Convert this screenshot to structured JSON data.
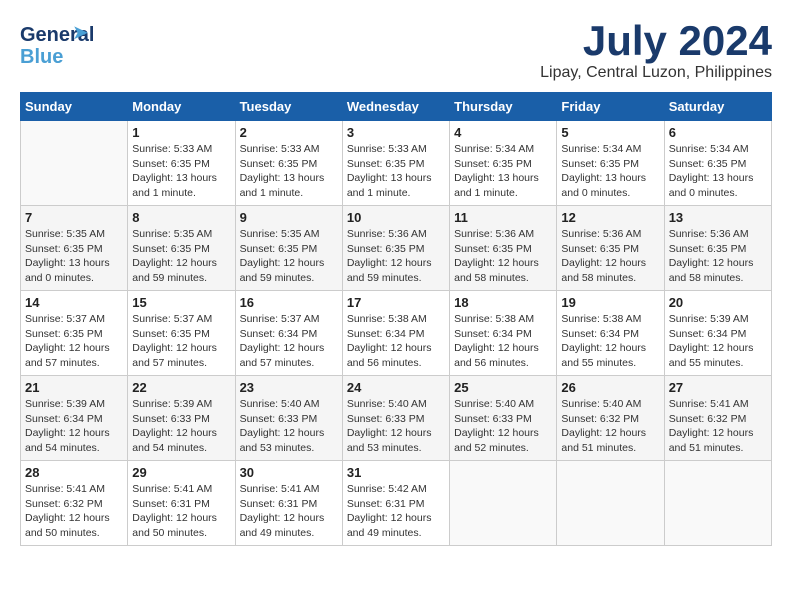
{
  "header": {
    "logo_line1": "General",
    "logo_line2": "Blue",
    "month_year": "July 2024",
    "location": "Lipay, Central Luzon, Philippines"
  },
  "weekdays": [
    "Sunday",
    "Monday",
    "Tuesday",
    "Wednesday",
    "Thursday",
    "Friday",
    "Saturday"
  ],
  "weeks": [
    [
      {
        "day": "",
        "empty": true
      },
      {
        "day": "1",
        "sunrise": "5:33 AM",
        "sunset": "6:35 PM",
        "daylight": "13 hours and 1 minute."
      },
      {
        "day": "2",
        "sunrise": "5:33 AM",
        "sunset": "6:35 PM",
        "daylight": "13 hours and 1 minute."
      },
      {
        "day": "3",
        "sunrise": "5:33 AM",
        "sunset": "6:35 PM",
        "daylight": "13 hours and 1 minute."
      },
      {
        "day": "4",
        "sunrise": "5:34 AM",
        "sunset": "6:35 PM",
        "daylight": "13 hours and 1 minute."
      },
      {
        "day": "5",
        "sunrise": "5:34 AM",
        "sunset": "6:35 PM",
        "daylight": "13 hours and 0 minutes."
      },
      {
        "day": "6",
        "sunrise": "5:34 AM",
        "sunset": "6:35 PM",
        "daylight": "13 hours and 0 minutes."
      }
    ],
    [
      {
        "day": "7",
        "sunrise": "5:35 AM",
        "sunset": "6:35 PM",
        "daylight": "13 hours and 0 minutes."
      },
      {
        "day": "8",
        "sunrise": "5:35 AM",
        "sunset": "6:35 PM",
        "daylight": "12 hours and 59 minutes."
      },
      {
        "day": "9",
        "sunrise": "5:35 AM",
        "sunset": "6:35 PM",
        "daylight": "12 hours and 59 minutes."
      },
      {
        "day": "10",
        "sunrise": "5:36 AM",
        "sunset": "6:35 PM",
        "daylight": "12 hours and 59 minutes."
      },
      {
        "day": "11",
        "sunrise": "5:36 AM",
        "sunset": "6:35 PM",
        "daylight": "12 hours and 58 minutes."
      },
      {
        "day": "12",
        "sunrise": "5:36 AM",
        "sunset": "6:35 PM",
        "daylight": "12 hours and 58 minutes."
      },
      {
        "day": "13",
        "sunrise": "5:36 AM",
        "sunset": "6:35 PM",
        "daylight": "12 hours and 58 minutes."
      }
    ],
    [
      {
        "day": "14",
        "sunrise": "5:37 AM",
        "sunset": "6:35 PM",
        "daylight": "12 hours and 57 minutes."
      },
      {
        "day": "15",
        "sunrise": "5:37 AM",
        "sunset": "6:35 PM",
        "daylight": "12 hours and 57 minutes."
      },
      {
        "day": "16",
        "sunrise": "5:37 AM",
        "sunset": "6:34 PM",
        "daylight": "12 hours and 57 minutes."
      },
      {
        "day": "17",
        "sunrise": "5:38 AM",
        "sunset": "6:34 PM",
        "daylight": "12 hours and 56 minutes."
      },
      {
        "day": "18",
        "sunrise": "5:38 AM",
        "sunset": "6:34 PM",
        "daylight": "12 hours and 56 minutes."
      },
      {
        "day": "19",
        "sunrise": "5:38 AM",
        "sunset": "6:34 PM",
        "daylight": "12 hours and 55 minutes."
      },
      {
        "day": "20",
        "sunrise": "5:39 AM",
        "sunset": "6:34 PM",
        "daylight": "12 hours and 55 minutes."
      }
    ],
    [
      {
        "day": "21",
        "sunrise": "5:39 AM",
        "sunset": "6:34 PM",
        "daylight": "12 hours and 54 minutes."
      },
      {
        "day": "22",
        "sunrise": "5:39 AM",
        "sunset": "6:33 PM",
        "daylight": "12 hours and 54 minutes."
      },
      {
        "day": "23",
        "sunrise": "5:40 AM",
        "sunset": "6:33 PM",
        "daylight": "12 hours and 53 minutes."
      },
      {
        "day": "24",
        "sunrise": "5:40 AM",
        "sunset": "6:33 PM",
        "daylight": "12 hours and 53 minutes."
      },
      {
        "day": "25",
        "sunrise": "5:40 AM",
        "sunset": "6:33 PM",
        "daylight": "12 hours and 52 minutes."
      },
      {
        "day": "26",
        "sunrise": "5:40 AM",
        "sunset": "6:32 PM",
        "daylight": "12 hours and 51 minutes."
      },
      {
        "day": "27",
        "sunrise": "5:41 AM",
        "sunset": "6:32 PM",
        "daylight": "12 hours and 51 minutes."
      }
    ],
    [
      {
        "day": "28",
        "sunrise": "5:41 AM",
        "sunset": "6:32 PM",
        "daylight": "12 hours and 50 minutes."
      },
      {
        "day": "29",
        "sunrise": "5:41 AM",
        "sunset": "6:31 PM",
        "daylight": "12 hours and 50 minutes."
      },
      {
        "day": "30",
        "sunrise": "5:41 AM",
        "sunset": "6:31 PM",
        "daylight": "12 hours and 49 minutes."
      },
      {
        "day": "31",
        "sunrise": "5:42 AM",
        "sunset": "6:31 PM",
        "daylight": "12 hours and 49 minutes."
      },
      {
        "day": "",
        "empty": true
      },
      {
        "day": "",
        "empty": true
      },
      {
        "day": "",
        "empty": true
      }
    ]
  ]
}
